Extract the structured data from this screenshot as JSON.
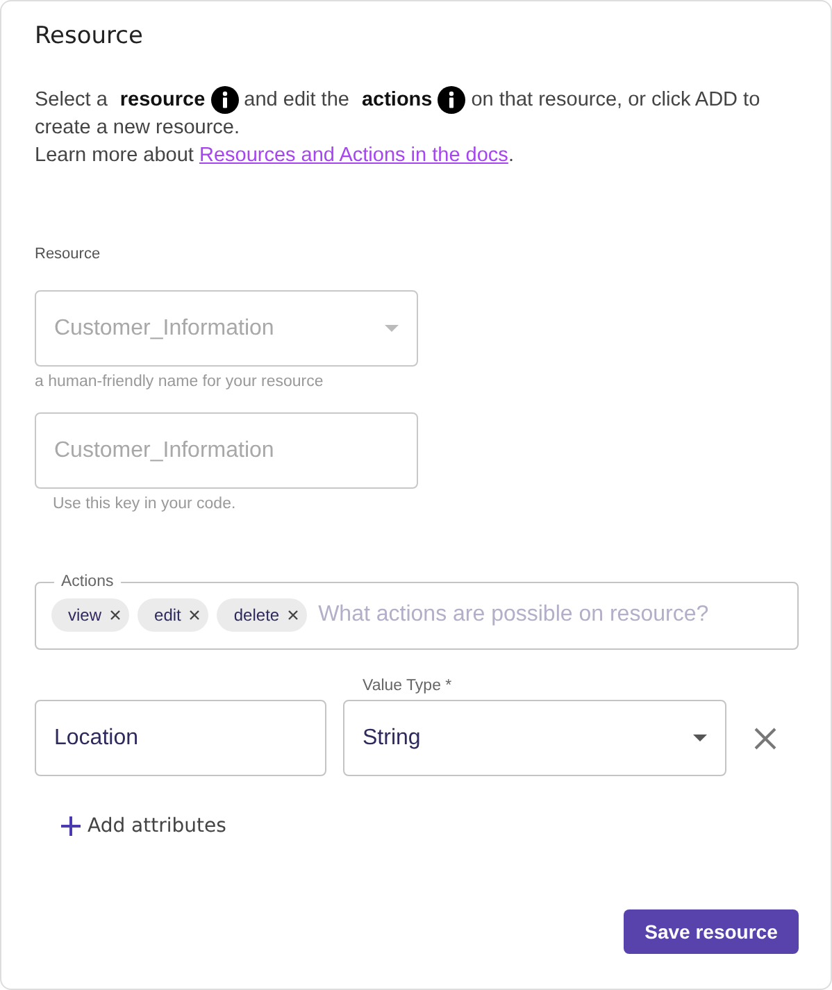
{
  "title": "Resource",
  "intro": [
    {
      "kind": "text",
      "text": "Select a"
    },
    {
      "kind": "term",
      "text": "resource"
    },
    {
      "kind": "info"
    },
    {
      "kind": "text",
      "text": "and edit the"
    },
    {
      "kind": "term",
      "text": "actions"
    },
    {
      "kind": "info"
    },
    {
      "kind": "text",
      "text": "on that resource, or click ADD to"
    },
    {
      "kind": "text",
      "text": "create a new resource."
    }
  ],
  "learn_more": {
    "text": "Learn more about",
    "link": "Resources and Actions in the docs",
    "end": "."
  },
  "section_label": "Resource",
  "resource_select": {
    "value": "Customer_Information",
    "disabled": true,
    "helper": "a human-friendly name for your resource"
  },
  "key_field": {
    "value": "Customer_Information",
    "disabled": true,
    "helper": "Use this key in your code."
  },
  "actions": {
    "label": "Actions",
    "chips": [
      "view",
      "edit",
      "delete"
    ],
    "placeholder": "What actions are possible on resource?"
  },
  "attribute": {
    "name": "Location",
    "type_label": "Value Type *",
    "type": "String"
  },
  "add_attributes": "Add attributes",
  "save_button": "Save resource"
}
